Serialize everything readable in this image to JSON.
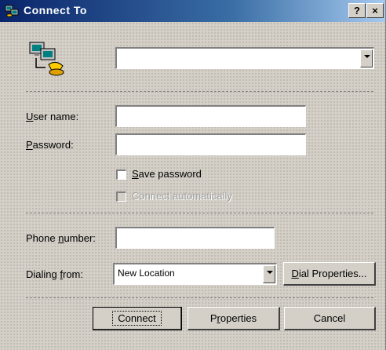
{
  "window": {
    "title": "Connect To",
    "help_button": "?",
    "close_button": "×"
  },
  "connection": {
    "selected": ""
  },
  "user_name": {
    "label_pre": "",
    "label_access": "U",
    "label_post": "ser name:",
    "value": ""
  },
  "password": {
    "label_pre": "",
    "label_access": "P",
    "label_post": "assword:",
    "value": ""
  },
  "save_password": {
    "label_access": "S",
    "label_post": "ave password",
    "checked": false
  },
  "connect_automatically": {
    "label": "Connect automatically",
    "enabled": false
  },
  "phone_number": {
    "label_pre": "Phone ",
    "label_access": "n",
    "label_post": "umber:",
    "value": ""
  },
  "dialing_from": {
    "label_pre": "Dialing ",
    "label_access": "f",
    "label_post": "rom:",
    "selected": "New Location",
    "properties_access": "D",
    "properties_post": "ial Properties..."
  },
  "buttons": {
    "connect": "Connect",
    "properties_pre": "P",
    "properties_access": "r",
    "properties_post": "operties",
    "cancel": "Cancel"
  },
  "icons": {
    "app": "network-computer-icon",
    "connection": "dialup-phone-computer-icon"
  },
  "colors": {
    "titlebar_start": "#0a246a",
    "titlebar_end": "#a6caf0",
    "face": "#d4d0c8"
  }
}
